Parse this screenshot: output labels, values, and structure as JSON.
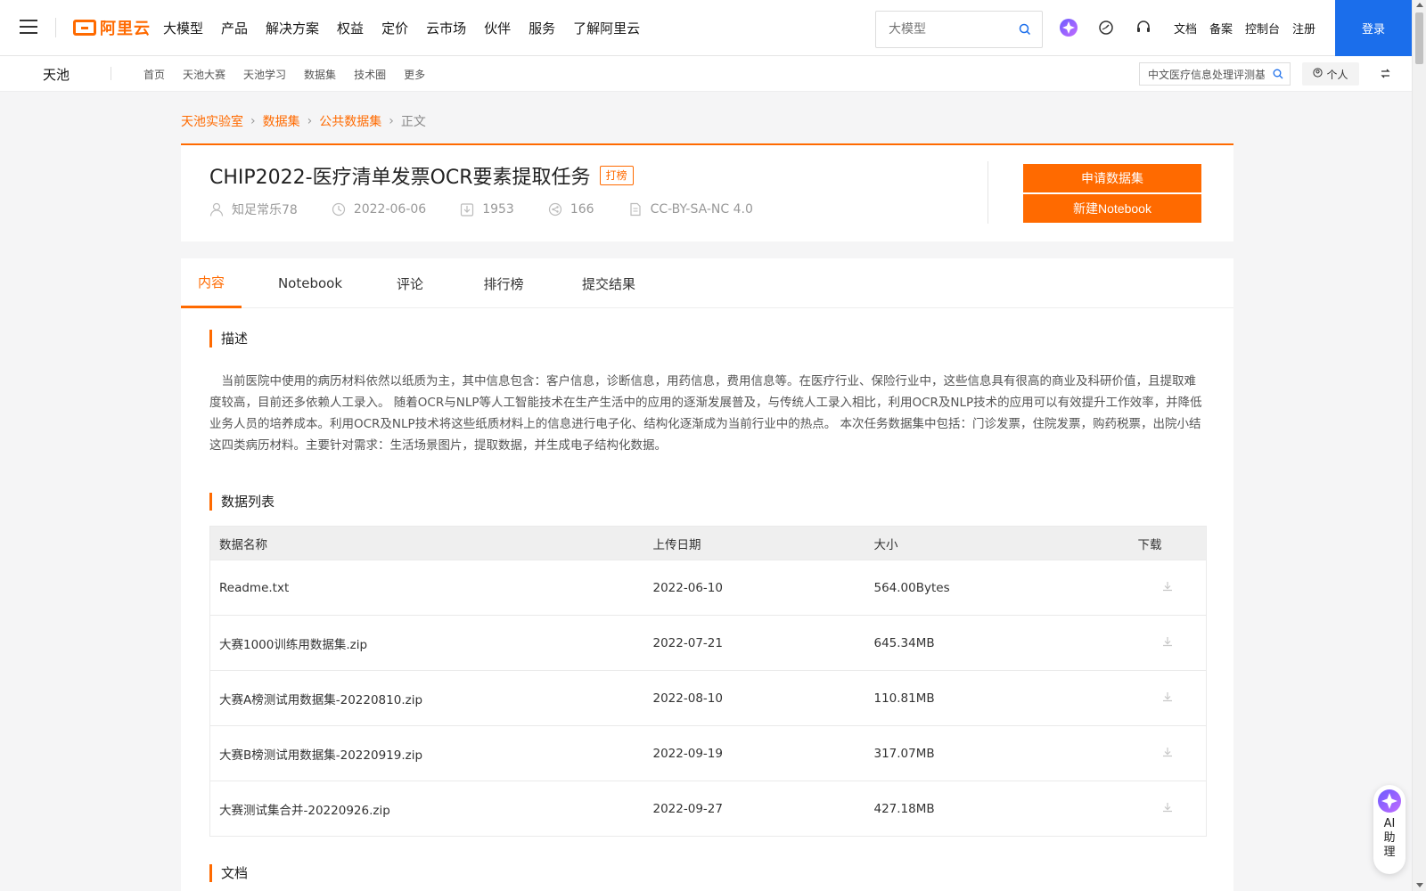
{
  "topnav": {
    "logo_text": "阿里云",
    "items": [
      "大模型",
      "产品",
      "解决方案",
      "权益",
      "定价",
      "云市场",
      "伙伴",
      "服务",
      "了解阿里云"
    ],
    "search_placeholder": "大模型",
    "links": [
      "文档",
      "备案",
      "控制台",
      "注册"
    ],
    "login": "登录"
  },
  "subnav": {
    "brand": "天池",
    "items": [
      "首页",
      "天池大赛",
      "天池学习",
      "数据集",
      "技术圈",
      "更多"
    ],
    "search_value": "中文医疗信息处理评测基",
    "personal": "个人"
  },
  "breadcrumb": {
    "items": [
      "天池实验室",
      "数据集",
      "公共数据集"
    ],
    "current": "正文"
  },
  "dataset": {
    "title": "CHIP2022-医疗清单发票OCR要素提取任务",
    "badge": "打榜",
    "author": "知足常乐78",
    "date": "2022-06-06",
    "downloads": "1953",
    "shares": "166",
    "license": "CC-BY-SA-NC 4.0",
    "apply_label": "申请数据集",
    "notebook_label": "新建Notebook"
  },
  "tabs": [
    "内容",
    "Notebook",
    "评论",
    "排行榜",
    "提交结果"
  ],
  "description": {
    "heading": "描述",
    "text": "当前医院中使用的病历材料依然以纸质为主，其中信息包含：客户信息，诊断信息，用药信息，费用信息等。在医疗行业、保险行业中，这些信息具有很高的商业及科研价值，且提取难度较高，目前还多依赖人工录入。 随着OCR与NLP等人工智能技术在生产生活中的应用的逐渐发展普及，与传统人工录入相比，利用OCR及NLP技术的应用可以有效提升工作效率，并降低业务人员的培养成本。利用OCR及NLP技术将这些纸质材料上的信息进行电子化、结构化逐渐成为当前行业中的热点。 本次任务数据集中包括：门诊发票，住院发票，购药税票，出院小结这四类病历材料。主要针对需求：生活场景图片，提取数据，并生成电子结构化数据。"
  },
  "data_list": {
    "heading": "数据列表",
    "columns": [
      "数据名称",
      "上传日期",
      "大小",
      "下载"
    ],
    "rows": [
      {
        "name": "Readme.txt",
        "date": "2022-06-10",
        "size": "564.00Bytes"
      },
      {
        "name": "大赛1000训练用数据集.zip",
        "date": "2022-07-21",
        "size": "645.34MB"
      },
      {
        "name": "大赛A榜测试用数据集-20220810.zip",
        "date": "2022-08-10",
        "size": "110.81MB"
      },
      {
        "name": "大赛B榜测试用数据集-20220919.zip",
        "date": "2022-09-19",
        "size": "317.07MB"
      },
      {
        "name": "大赛测试集合并-20220926.zip",
        "date": "2022-09-27",
        "size": "427.18MB"
      }
    ]
  },
  "docs": {
    "heading": "文档"
  },
  "ai_assistant": {
    "label": "AI助理"
  },
  "colors": {
    "accent": "#ff6a00",
    "login": "#1b6eeb"
  }
}
